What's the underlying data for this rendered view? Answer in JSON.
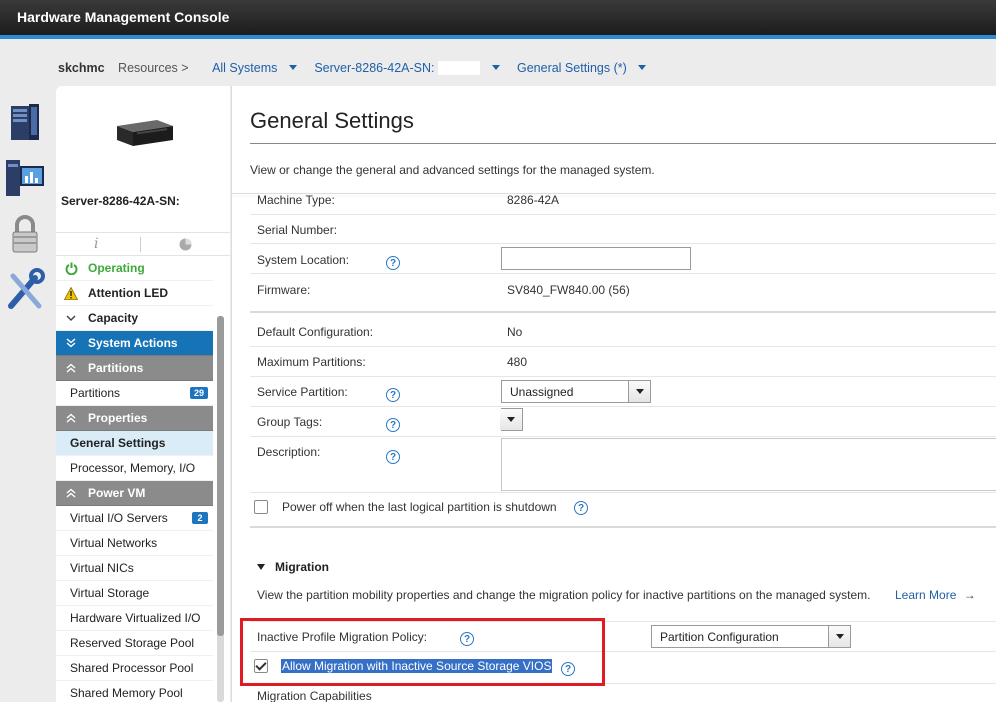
{
  "app": {
    "title": "Hardware Management Console"
  },
  "breadcrumb": {
    "host": "skchmc",
    "resources": "Resources >",
    "all_systems": "All Systems",
    "server": "Server-8286-42A-SN:",
    "page": "General Settings (*)"
  },
  "sidebar": {
    "server_name": "Server-8286-42A-SN:",
    "tab_info": "i",
    "status_items": [
      {
        "label": "Operating"
      },
      {
        "label": "Attention LED"
      },
      {
        "label": "Capacity"
      }
    ],
    "system_actions": "System Actions",
    "partitions_header": "Partitions",
    "partitions_item": {
      "label": "Partitions",
      "count": "29"
    },
    "properties_header": "Properties",
    "properties_items": [
      {
        "label": "General Settings"
      },
      {
        "label": "Processor, Memory, I/O"
      }
    ],
    "powervm_header": "Power VM",
    "powervm_items": [
      {
        "label": "Virtual I/O Servers",
        "count": "2"
      },
      {
        "label": "Virtual Networks"
      },
      {
        "label": "Virtual NICs"
      },
      {
        "label": "Virtual Storage"
      },
      {
        "label": "Hardware Virtualized I/O"
      },
      {
        "label": "Reserved Storage Pool"
      },
      {
        "label": "Shared Processor Pool"
      },
      {
        "label": "Shared Memory Pool"
      }
    ]
  },
  "main": {
    "title": "General Settings",
    "description": "View or change the general and advanced settings for the managed system.",
    "fields": {
      "machine_type": {
        "label": "Machine Type:",
        "value": "8286-42A"
      },
      "serial_number": {
        "label": "Serial Number:",
        "value": ""
      },
      "system_location": {
        "label": "System Location:",
        "value": ""
      },
      "firmware": {
        "label": "Firmware:",
        "value": "SV840_FW840.00 (56)"
      },
      "default_config": {
        "label": "Default Configuration:",
        "value": "No"
      },
      "max_partitions": {
        "label": "Maximum Partitions:",
        "value": "480"
      },
      "service_partition": {
        "label": "Service Partition:",
        "value": "Unassigned"
      },
      "group_tags": {
        "label": "Group Tags:",
        "value": ""
      },
      "description": {
        "label": "Description:",
        "value": ""
      }
    },
    "power_off_label": "Power off when the last logical partition is shutdown",
    "help_glyph": "?",
    "migration": {
      "heading": "Migration",
      "description": "View the partition mobility properties and change the migration policy for inactive partitions on the managed system.",
      "learn_more": "Learn More",
      "policy_label": "Inactive Profile Migration Policy:",
      "policy_value": "Partition Configuration",
      "allow_label": "Allow Migration with Inactive Source Storage VIOS",
      "capabilities_label": "Migration Capabilities"
    }
  },
  "colors": {
    "accent": "#2e8ad8",
    "link": "#1f5fa8",
    "operating_green": "#3ea83a",
    "highlight_red": "#e01b24",
    "selection_blue": "#3670c6"
  }
}
